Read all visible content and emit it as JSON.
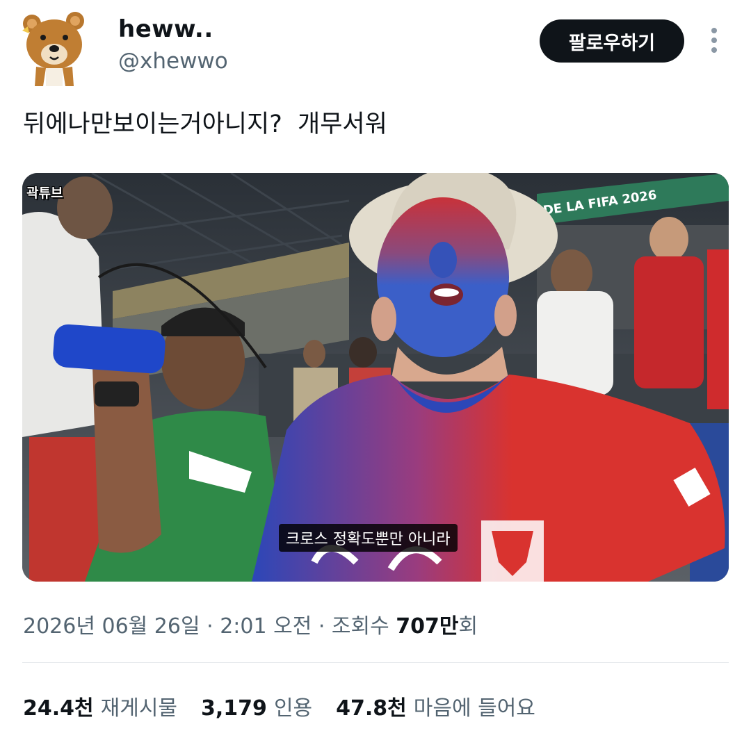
{
  "user": {
    "display_name": "heww..",
    "handle": "@xhewwo",
    "avatar_icon": "bear-avatar-icon"
  },
  "actions": {
    "follow_label": "팔로우하기",
    "more_icon": "more-vertical-icon"
  },
  "tweet": {
    "text": "뒤에나만보이는거아니지?  개무서워"
  },
  "media": {
    "watermark": "곽튜브",
    "subtitle": "크로스 정확도뿐만 아니라",
    "banner_text": "DE LA FIFA 2026",
    "colors": {
      "face_blue": "#3b5fc8",
      "face_red": "#c8323a",
      "jersey_red": "#d9332f",
      "jersey_blue": "#2c47b8",
      "mexico_green": "#2f8a48"
    }
  },
  "meta": {
    "date": "2026년 06월 26일",
    "separator": " · ",
    "time": "2:01 오전",
    "views_prefix": "조회수 ",
    "views_value": "707만",
    "views_suffix": "회"
  },
  "stats": {
    "reposts_value": "24.4천",
    "reposts_label": "재게시물",
    "quotes_value": "3,179",
    "quotes_label": "인용",
    "likes_value": "47.8천",
    "likes_label": "마음에 들어요"
  }
}
